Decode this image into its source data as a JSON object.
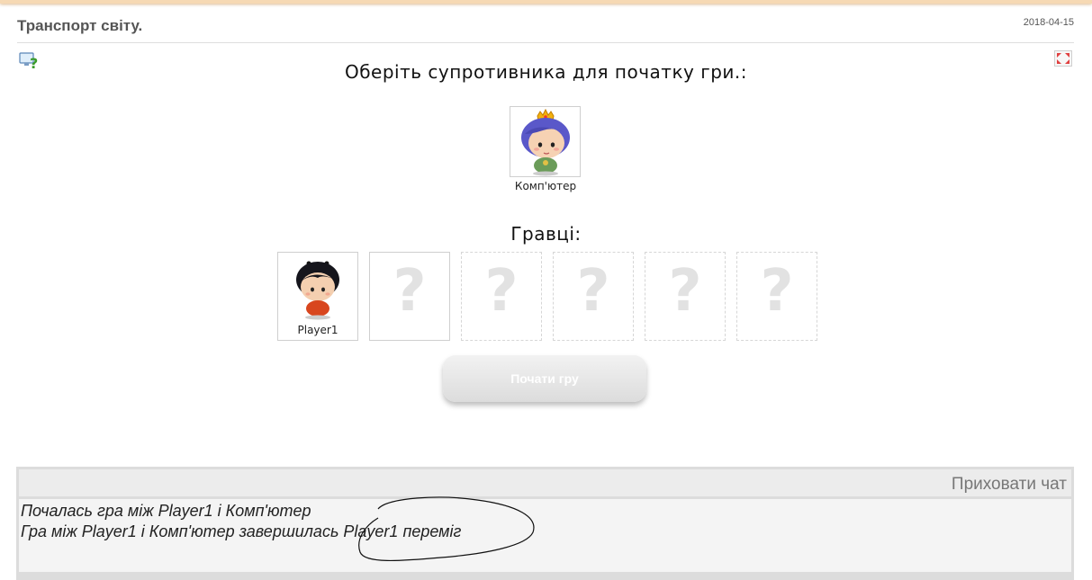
{
  "header": {
    "title": "Транспорт світу.",
    "date": "2018-04-15"
  },
  "game": {
    "choose_heading": "Оберіть супротивника для початку гри.:",
    "opponent": {
      "name": "Комп'ютер",
      "avatar": "princess-avatar"
    },
    "players_heading": "Гравці:",
    "players": [
      {
        "name": "Player1",
        "avatar": "boy-avatar"
      },
      {
        "name": "?",
        "empty": true
      },
      {
        "name": "?",
        "empty": true
      },
      {
        "name": "?",
        "empty": true
      },
      {
        "name": "?",
        "empty": true
      },
      {
        "name": "?",
        "empty": true
      }
    ],
    "start_button": "Почати гру",
    "start_disabled": true
  },
  "chat": {
    "hide_label": "Приховати чат",
    "messages": [
      "Почалась гра між Player1 і Комп'ютер",
      "Гра між Player1 і Комп'ютер завершилась Player1 переміг"
    ]
  },
  "colors": {
    "accent_bar": "#f6d9b4",
    "chat_bg": "#dcdcdc",
    "placeholder": "#e2e2e2"
  },
  "icons": {
    "help": "help-question-icon",
    "fullscreen": "fullscreen-icon"
  }
}
